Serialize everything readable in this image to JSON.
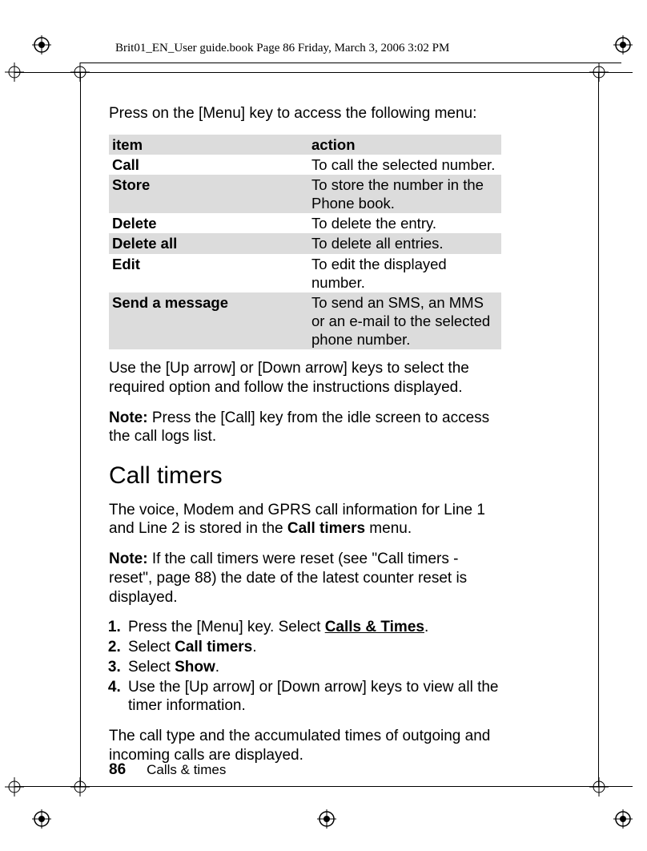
{
  "header": {
    "running": "Brit01_EN_User guide.book  Page 86  Friday, March 3, 2006  3:02 PM"
  },
  "intro": "Press on the [Menu] key to access the following menu:",
  "table": {
    "head": {
      "c1": "item",
      "c2": "action"
    },
    "rows": [
      {
        "c1": "Call",
        "c2": "To call the selected number."
      },
      {
        "c1": "Store",
        "c2": "To store the number in the Phone book."
      },
      {
        "c1": "Delete",
        "c2": "To delete the entry."
      },
      {
        "c1": "Delete all",
        "c2": "To delete all entries."
      },
      {
        "c1": "Edit",
        "c2": "To edit the displayed number."
      },
      {
        "c1": "Send a message",
        "c2": "To send an SMS, an MMS or an e-mail to the selected phone number."
      }
    ]
  },
  "after_table": "Use the [Up arrow] or [Down arrow] keys to select the required option and follow the instructions displayed.",
  "note1_label": "Note:",
  "note1_body": " Press the [Call] key from the idle screen to access the call logs list.",
  "section_title": "Call timers",
  "para2_a": "The voice, Modem and GPRS call information for Line 1 and Line 2 is stored in the ",
  "para2_b": "Call timers",
  "para2_c": " menu.",
  "note2_label": "Note:",
  "note2_body": " If the call timers were reset (see \"Call timers - reset\", page 88) the date of the latest counter reset is displayed.",
  "steps": {
    "s1a": "Press the [Menu] key. Select ",
    "s1b": "Calls & Times",
    "s1c": ".",
    "s2a": "Select ",
    "s2b": "Call timers",
    "s2c": ".",
    "s3a": "Select ",
    "s3b": "Show",
    "s3c": ".",
    "s4": "Use the [Up arrow] or [Down arrow] keys to view all the timer information."
  },
  "closing": "The call type and the accumulated times of outgoing and incoming calls are displayed.",
  "footer": {
    "page": "86",
    "section": "Calls & times"
  }
}
